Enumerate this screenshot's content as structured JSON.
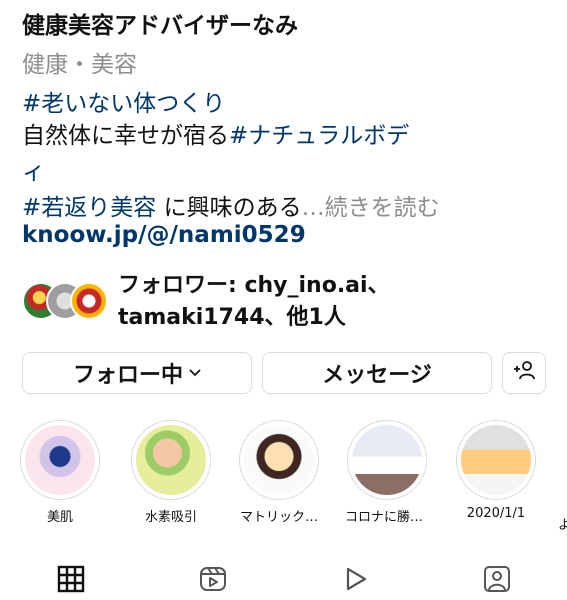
{
  "profile": {
    "name": "健康美容アドバイザーなみ",
    "category": "健康・美容",
    "bio_tag1": "#老いない体つくり",
    "bio_line2_text": "自然体に幸せが宿る",
    "bio_tag2": "#ナチュラルボデ",
    "bio_line3": "ィ",
    "bio_tag3": "#若返り美容",
    "bio_line4_text": " に興味のある",
    "ellipsis": "…",
    "more_label": "続きを読む",
    "link": "knoow.jp/@/nami0529"
  },
  "followers": {
    "text": "フォロワー: chy_ino.ai、tamaki1744、他1人"
  },
  "buttons": {
    "follow_label": "フォロー中",
    "message_label": "メッセージ"
  },
  "stories": [
    {
      "label": "美肌"
    },
    {
      "label": "水素吸引"
    },
    {
      "label": "マトリック…"
    },
    {
      "label": "コロナに勝つ…"
    },
    {
      "label": "2020/1/1"
    }
  ],
  "story_partial_label": "よ",
  "tabs": {
    "icons": [
      "grid-icon",
      "reels-icon",
      "play-icon",
      "tagged-icon"
    ]
  }
}
